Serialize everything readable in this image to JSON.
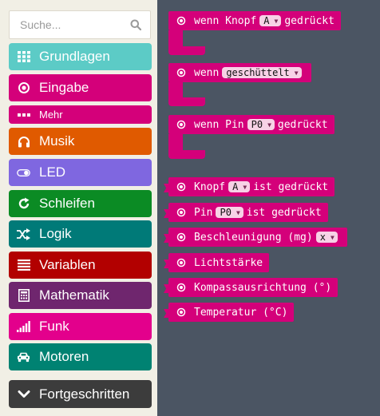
{
  "search": {
    "placeholder": "Suche..."
  },
  "toolbox": {
    "categories": [
      {
        "label": "Grundlagen",
        "icon": "grid-icon",
        "color": "#5ccbc6"
      },
      {
        "label": "Eingabe",
        "icon": "radio-target-icon",
        "color": "#d4007a"
      },
      {
        "label": "Mehr",
        "icon": "more-dots-icon",
        "color": "#d4007a"
      },
      {
        "label": "Musik",
        "icon": "headphones-icon",
        "color": "#e05a00"
      },
      {
        "label": "LED",
        "icon": "toggle-icon",
        "color": "#7f67e0"
      },
      {
        "label": "Schleifen",
        "icon": "refresh-icon",
        "color": "#0b8b24"
      },
      {
        "label": "Logik",
        "icon": "shuffle-icon",
        "color": "#007a78"
      },
      {
        "label": "Variablen",
        "icon": "list-icon",
        "color": "#b20000"
      },
      {
        "label": "Mathematik",
        "icon": "calculator-icon",
        "color": "#6f266e"
      },
      {
        "label": "Funk",
        "icon": "signal-bars-icon",
        "color": "#e3008c"
      },
      {
        "label": "Motoren",
        "icon": "car-icon",
        "color": "#008272"
      },
      {
        "label": "Fortgeschritten",
        "icon": "chevron-down-icon",
        "color": "#3c3c3c"
      }
    ]
  },
  "workspace": {
    "block_color": "#d4007a",
    "events": [
      {
        "pre": "wenn Knopf",
        "dropdown": "A",
        "post": "gedrückt"
      },
      {
        "pre": "wenn",
        "dropdown": "geschüttelt",
        "post": ""
      },
      {
        "pre": "wenn Pin",
        "dropdown": "P0",
        "post": "gedrückt"
      }
    ],
    "reporters": [
      {
        "pre": "Knopf",
        "dropdown": "A",
        "post": "ist gedrückt"
      },
      {
        "pre": "Pin",
        "dropdown": "P0",
        "post": "ist gedrückt"
      },
      {
        "pre": "Beschleunigung (mg)",
        "dropdown": "x",
        "post": ""
      },
      {
        "pre": "Lichtstärke",
        "dropdown": "",
        "post": ""
      },
      {
        "pre": "Kompassausrichtung (°)",
        "dropdown": "",
        "post": ""
      },
      {
        "pre": "Temperatur (°C)",
        "dropdown": "",
        "post": ""
      }
    ]
  }
}
